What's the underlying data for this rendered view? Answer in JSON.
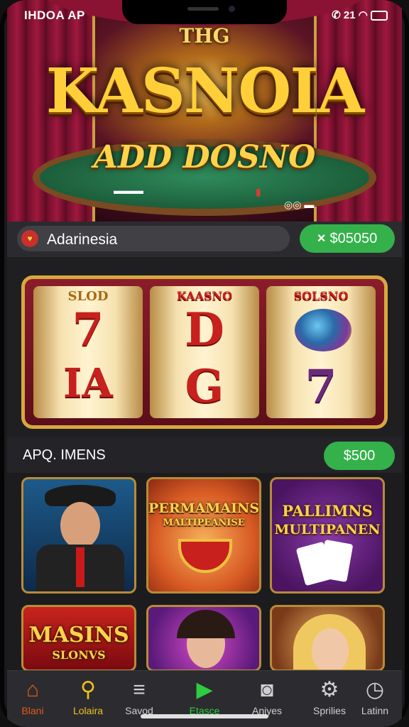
{
  "status_bar": {
    "left_text": "IHDOA AP",
    "right_text": "21"
  },
  "hero": {
    "subtitle": "THG",
    "title": "KASNOIA",
    "tagline": "ADD DOSNO"
  },
  "search": {
    "text": "Adarinesia"
  },
  "balance": {
    "icon": "×",
    "value": "$05050"
  },
  "slot": {
    "reels": [
      {
        "header": "SLOD",
        "symbol_top": "7",
        "symbol_bottom": "IA"
      },
      {
        "header": "KAASNO",
        "symbol_top": "D",
        "symbol_bottom": "G"
      },
      {
        "header": "SOLSNO",
        "symbol_top": "",
        "symbol_bottom": "7"
      }
    ]
  },
  "section": {
    "title": "APQ. IMENS",
    "pill": "$500"
  },
  "games": [
    {
      "title": "",
      "caption": ""
    },
    {
      "title": "PERMAMAINS",
      "caption": "MALTIPEANISE"
    },
    {
      "title": "PALLIMNS",
      "caption": "MULTIPANEN"
    },
    {
      "title": "MASINS",
      "caption": "SLONVS"
    },
    {
      "title": "",
      "caption": ""
    },
    {
      "title": "",
      "caption": ""
    }
  ],
  "tabs": [
    {
      "label": "Blani",
      "icon": "home-icon"
    },
    {
      "label": "Lolaira",
      "icon": "search-icon"
    },
    {
      "label": "Savod",
      "icon": "menu-icon"
    },
    {
      "label": "Etasce",
      "icon": "play-icon"
    },
    {
      "label": "Aniyes",
      "icon": "camera-icon"
    },
    {
      "label": "Sprilies",
      "icon": "gear-icon"
    },
    {
      "label": "Latinn",
      "icon": "clock-icon"
    }
  ],
  "colors": {
    "accent_green": "#34b14a",
    "gold": "#ffcf3a",
    "active_tab": "#f0c020",
    "play_green": "#2ecc40"
  }
}
